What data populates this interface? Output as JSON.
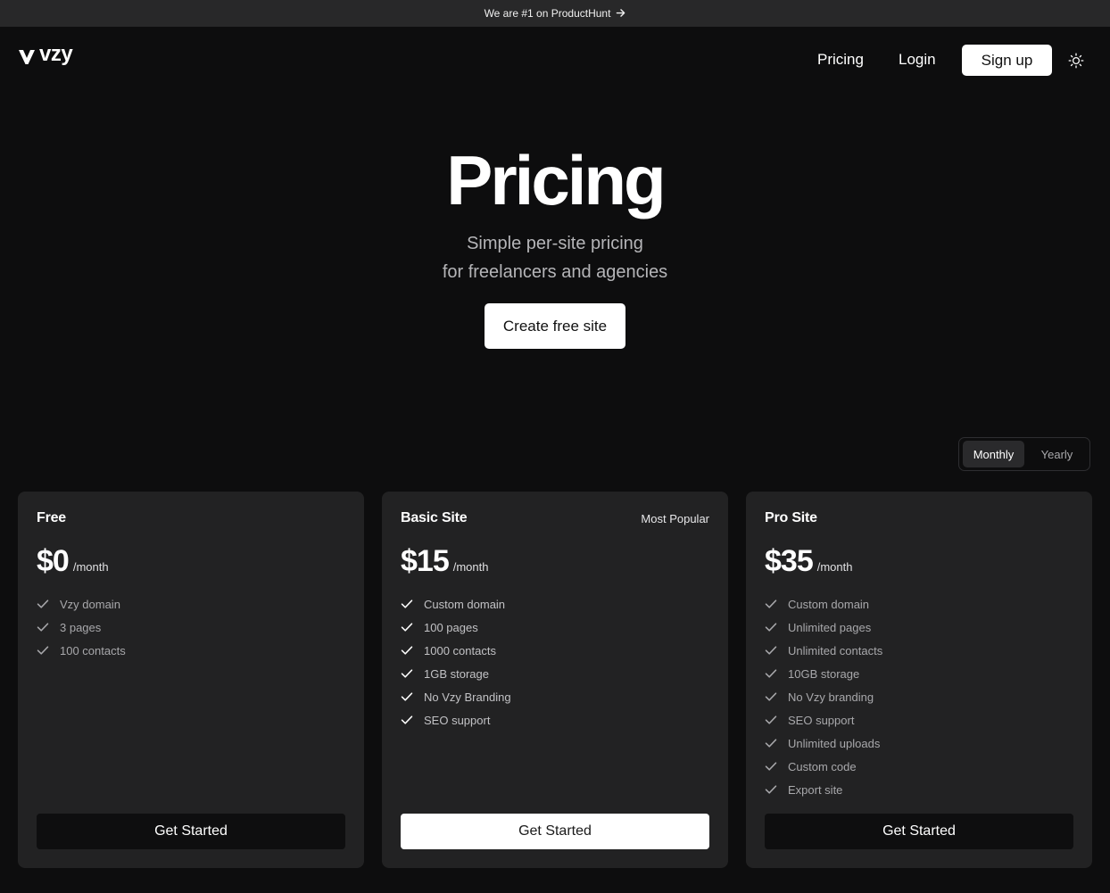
{
  "announcement": {
    "text": "We are #1 on ProductHunt",
    "icon": "arrow-right-icon"
  },
  "nav": {
    "logo_text": "vzy",
    "pricing": "Pricing",
    "login": "Login",
    "signup": "Sign up",
    "theme_icon": "sun-icon"
  },
  "hero": {
    "title": "Pricing",
    "subtitle_line1": "Simple per-site pricing",
    "subtitle_line2": "for freelancers and agencies",
    "cta": "Create free site"
  },
  "billing": {
    "monthly": "Monthly",
    "yearly": "Yearly",
    "selected": "Monthly"
  },
  "plans": [
    {
      "name": "Free",
      "badge": "",
      "price": "$0",
      "period": "/month",
      "features": [
        "Vzy domain",
        "3 pages",
        "100 contacts"
      ],
      "cta": "Get Started"
    },
    {
      "name": "Basic Site",
      "badge": "Most Popular",
      "price": "$15",
      "period": "/month",
      "features": [
        "Custom domain",
        "100 pages",
        "1000 contacts",
        "1GB storage",
        "No Vzy Branding",
        "SEO support"
      ],
      "cta": "Get Started"
    },
    {
      "name": "Pro Site",
      "badge": "",
      "price": "$35",
      "period": "/month",
      "features": [
        "Custom domain",
        "Unlimited pages",
        "Unlimited contacts",
        "10GB storage",
        "No Vzy branding",
        "SEO support",
        "Unlimited uploads",
        "Custom code",
        "Export site"
      ],
      "cta": "Get Started"
    }
  ],
  "colors": {
    "background": "#0d0d0e",
    "announcement_bar": "#282829",
    "card": "#222223",
    "accent_button": "#ffffff"
  }
}
